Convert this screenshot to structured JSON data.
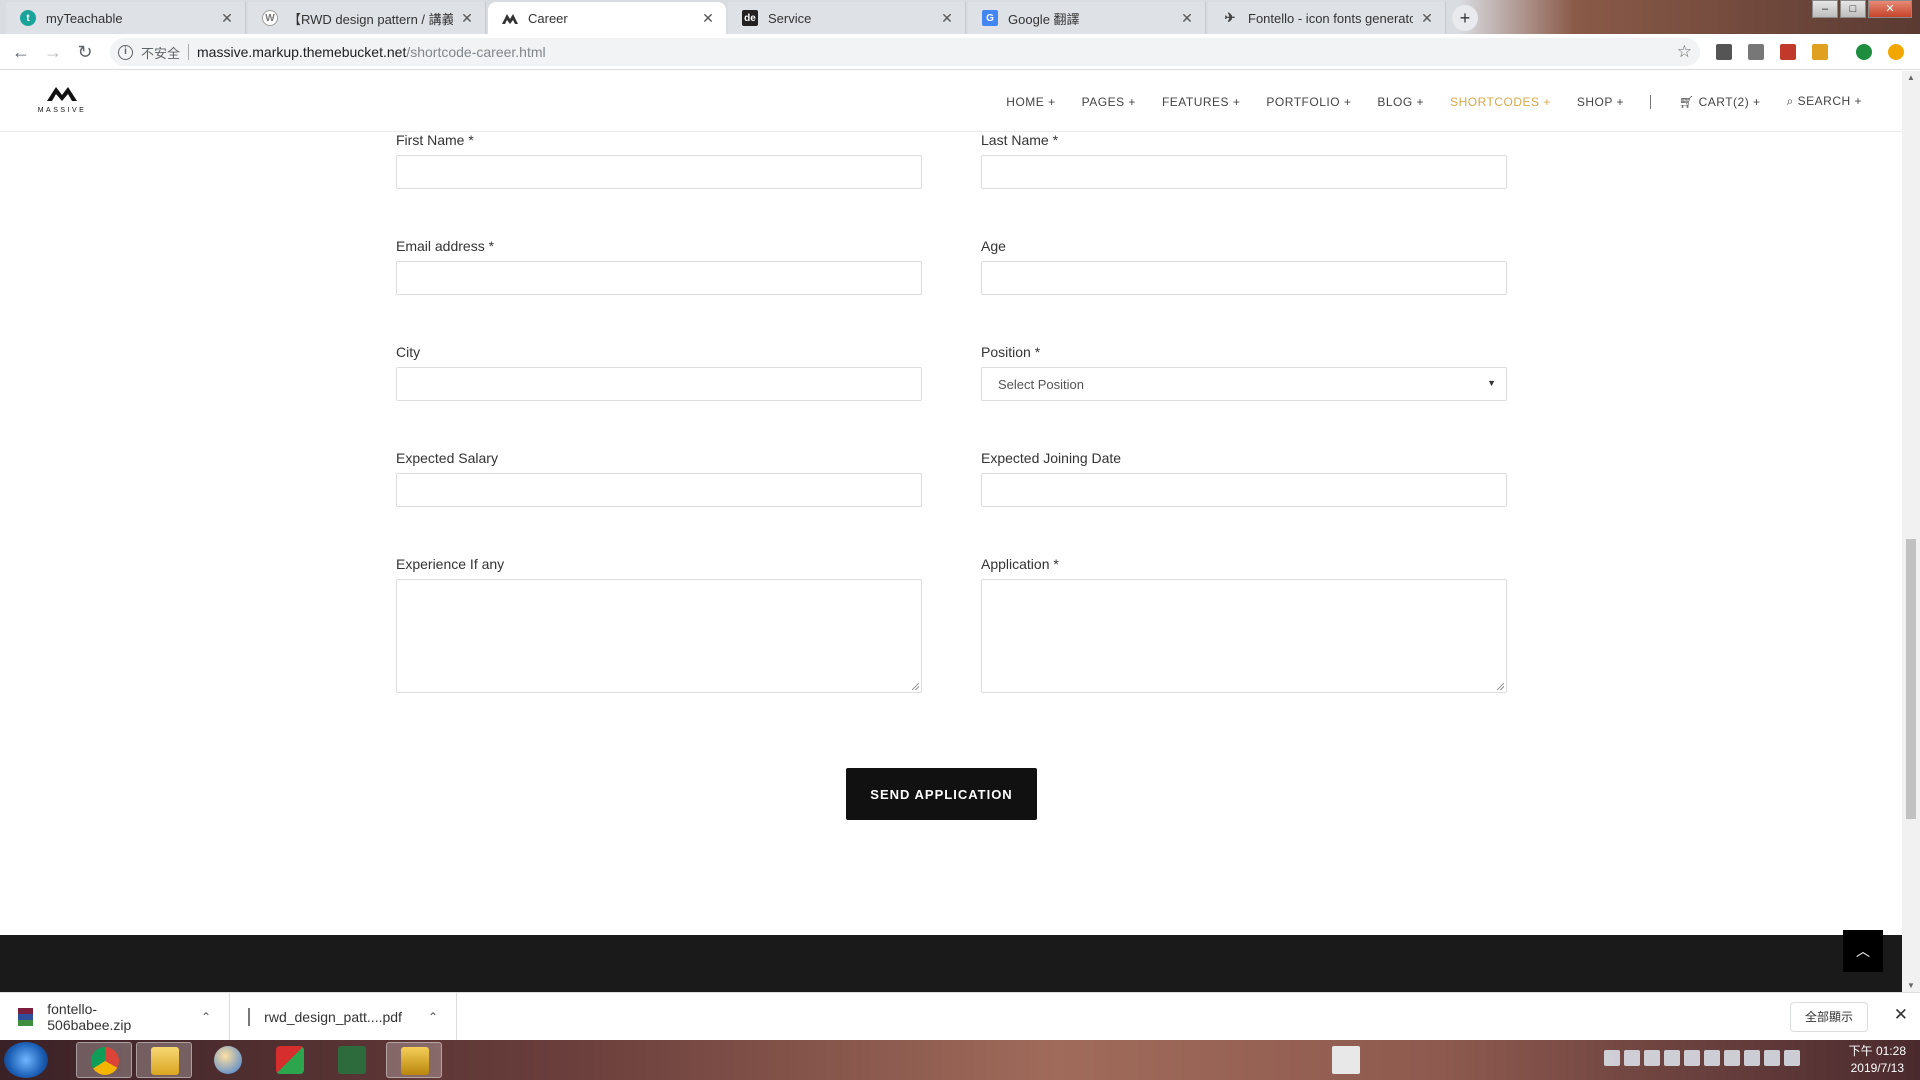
{
  "browser": {
    "tabs": [
      {
        "title": "myTeachable",
        "favicon_letter": "t",
        "favicon_color": "#1aa39a",
        "active": false
      },
      {
        "title": "【RWD design pattern / 講義下",
        "favicon_letter": "W",
        "favicon_color": "#9e9e9e",
        "active": false
      },
      {
        "title": "Career",
        "favicon_letter": "M",
        "favicon_color": "#333333",
        "active": true
      },
      {
        "title": "Service",
        "favicon_letter": "de",
        "favicon_color": "#222222",
        "active": false
      },
      {
        "title": "Google 翻譯",
        "favicon_letter": "G",
        "favicon_color": "#4285f4",
        "active": false
      },
      {
        "title": "Fontello - icon fonts generator",
        "favicon_letter": "✈",
        "favicon_color": "#444444",
        "active": false
      }
    ],
    "new_tab_label": "+",
    "security_label": "不安全",
    "url_host": "massive.markup.themebucket.net",
    "url_path": "/shortcode-career.html"
  },
  "site": {
    "logo_text": "MASSIVE",
    "nav": [
      {
        "label": "HOME +",
        "active": false
      },
      {
        "label": "PAGES +",
        "active": false
      },
      {
        "label": "FEATURES +",
        "active": false
      },
      {
        "label": "PORTFOLIO  +",
        "active": false
      },
      {
        "label": "BLOG +",
        "active": false
      },
      {
        "label": "SHORTCODES +",
        "active": true
      },
      {
        "label": "SHOP +",
        "active": false
      }
    ],
    "cart_label": "CART(2) +",
    "search_label": "SEARCH +",
    "accent_color": "#d6a94b"
  },
  "form": {
    "first_name": {
      "label": "First Name *",
      "value": ""
    },
    "last_name": {
      "label": "Last Name *",
      "value": ""
    },
    "email": {
      "label": "Email address *",
      "value": ""
    },
    "age": {
      "label": "Age",
      "value": ""
    },
    "city": {
      "label": "City",
      "value": ""
    },
    "position": {
      "label": "Position *",
      "selected": "Select Position"
    },
    "expected_salary": {
      "label": "Expected Salary",
      "value": ""
    },
    "joining_date": {
      "label": "Expected Joining Date",
      "value": ""
    },
    "experience": {
      "label": "Experience If any",
      "value": ""
    },
    "application": {
      "label": "Application *",
      "value": ""
    },
    "submit_label": "SEND APPLICATION"
  },
  "downloads": {
    "items": [
      {
        "name": "fontello-506babee.zip",
        "icon": "archive-icon"
      },
      {
        "name": "rwd_design_patt....pdf",
        "icon": "file-icon"
      }
    ],
    "show_all_label": "全部顯示"
  },
  "taskbar": {
    "time": "下午 01:28",
    "date": "2019/7/13"
  }
}
